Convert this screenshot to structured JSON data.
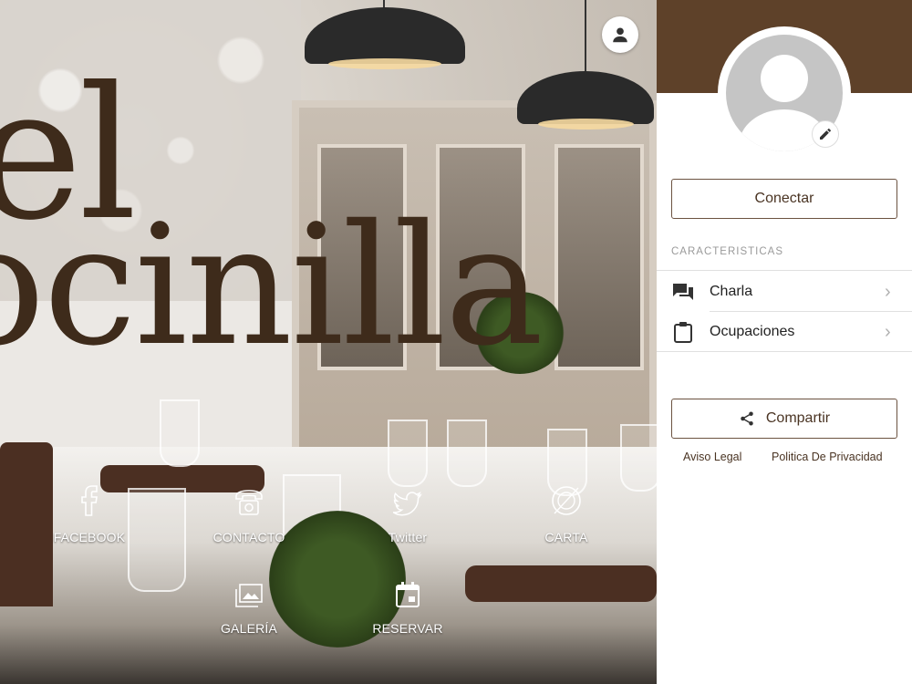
{
  "hero": {
    "logo_line1": "el",
    "logo_line2": "ocinilla",
    "menu": [
      {
        "label": "FACEBOOK",
        "icon": "facebook-icon"
      },
      {
        "label": "CONTACTO",
        "icon": "phone-icon"
      },
      {
        "label": "Twitter",
        "icon": "twitter-icon"
      },
      {
        "label": "CARTA",
        "icon": "food-menu-icon"
      },
      {
        "label": "GALERÍA",
        "icon": "gallery-icon"
      },
      {
        "label": "RESERVAR",
        "icon": "calendar-icon"
      }
    ]
  },
  "panel": {
    "connect_label": "Conectar",
    "features_title": "CARACTERISTICAS",
    "features": [
      {
        "label": "Charla",
        "icon": "chat-icon"
      },
      {
        "label": "Ocupaciones",
        "icon": "clipboard-icon"
      }
    ],
    "share_label": "Compartir",
    "footer": {
      "legal": "Aviso Legal",
      "privacy": "Politica De Privacidad"
    }
  },
  "colors": {
    "brand_brown": "#5e4129",
    "logo_brown": "#3e2b1b",
    "button_border": "#6b5240"
  }
}
